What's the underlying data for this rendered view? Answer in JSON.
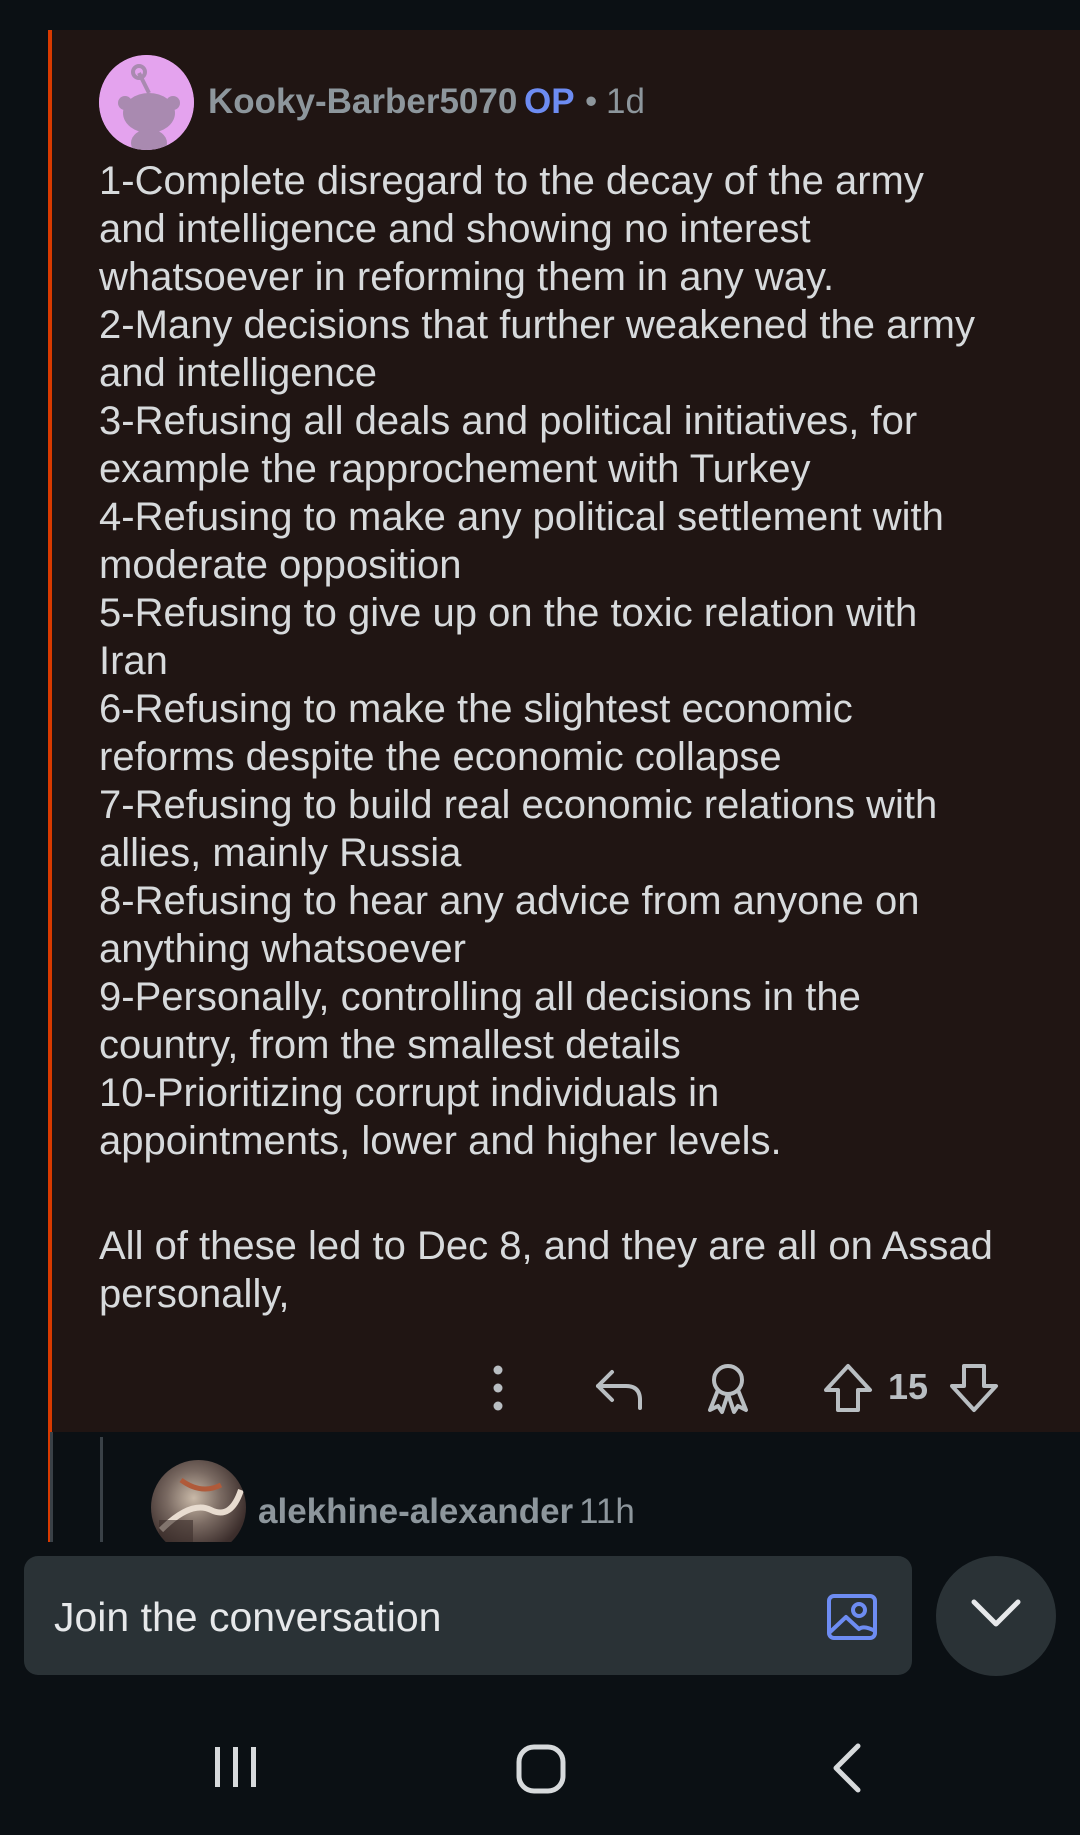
{
  "comment": {
    "username": "Kooky-Barber5070",
    "op_badge": "OP",
    "separator": "•",
    "time": "1d",
    "lines": [
      "1-Complete disregard to the decay of the army",
      "and intelligence and showing no interest",
      "whatsoever in reforming them in any way.",
      "2-Many decisions that further weakened the army",
      "and intelligence",
      "3-Refusing all deals and political initiatives, for",
      "example the rapprochement with Turkey",
      "4-Refusing to make any political settlement with",
      "moderate opposition",
      "5-Refusing to give up on the toxic relation with",
      "Iran",
      "6-Refusing to make the slightest economic",
      "reforms despite the economic collapse",
      "7-Refusing to build real economic relations with",
      "allies, mainly Russia",
      "8-Refusing to hear any advice from anyone on",
      "anything whatsoever",
      "9-Personally, controlling all decisions in the",
      "country, from the smallest details",
      "10-Prioritizing corrupt individuals in",
      "appointments, lower and higher levels."
    ],
    "closing_lines": [
      "All of these led to Dec 8, and they are all on Assad",
      "personally,"
    ],
    "vote_count": "15",
    "icons": {
      "more": "more-vertical-icon",
      "reply": "reply-icon",
      "award": "award-icon",
      "upvote": "upvote-icon",
      "downvote": "downvote-icon"
    }
  },
  "reply_preview": {
    "username": "alekhine-alexander",
    "time": "11h"
  },
  "composer": {
    "placeholder": "Join the conversation",
    "image_icon": "image-upload-icon",
    "collapse_icon": "chevron-down-icon"
  },
  "nav": {
    "recents_icon": "recents-icon",
    "home_icon": "home-icon",
    "back_icon": "back-icon"
  },
  "colors": {
    "thread_accent": "#d93a00",
    "op_badge": "#6d8cf2",
    "card_bg": "#201513",
    "page_bg": "#0b1014",
    "composer_bg": "#2a3236",
    "image_icon": "#6d8cf2"
  }
}
